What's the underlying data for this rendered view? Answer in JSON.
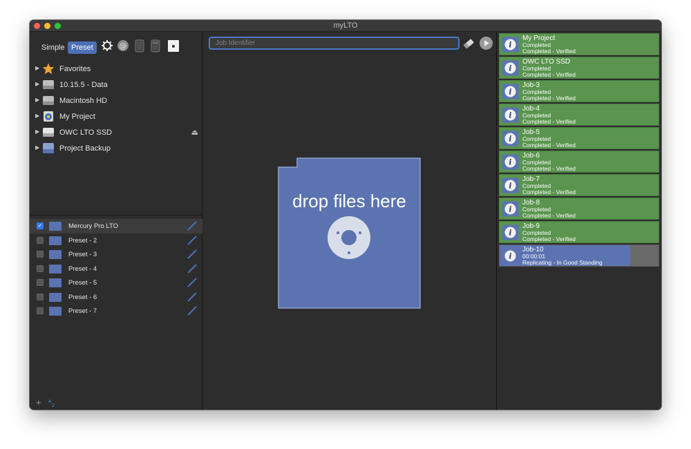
{
  "window": {
    "title": "myLTO"
  },
  "toolbar": {
    "simple_label": "Simple",
    "preset_label": "Preset"
  },
  "sources": [
    {
      "label": "Favorites",
      "icon": "star-icon"
    },
    {
      "label": "10.15.5 - Data",
      "icon": "drive-icon"
    },
    {
      "label": "Macintosh HD",
      "icon": "drive-icon"
    },
    {
      "label": "My Project",
      "icon": "project-icon"
    },
    {
      "label": "OWC LTO SSD",
      "icon": "drive-icon"
    },
    {
      "label": "Project Backup",
      "icon": "backup-drive-icon"
    }
  ],
  "presets": [
    {
      "label": "Mercury Pro LTO",
      "checked": true
    },
    {
      "label": "Preset - 2",
      "checked": false
    },
    {
      "label": "Preset - 3",
      "checked": false
    },
    {
      "label": "Preset - 4",
      "checked": false
    },
    {
      "label": "Preset - 5",
      "checked": false
    },
    {
      "label": "Preset - 6",
      "checked": false
    },
    {
      "label": "Preset - 7",
      "checked": false
    }
  ],
  "job_input": {
    "placeholder": "Job Identifier"
  },
  "drop_zone": {
    "text": "drop files here"
  },
  "jobs": [
    {
      "name": "My Project",
      "line2": "Completed",
      "line3": "Completed - Verified",
      "state": "done"
    },
    {
      "name": "OWC LTO SSD",
      "line2": "Completed",
      "line3": "Completed - Verified",
      "state": "done"
    },
    {
      "name": "Job-3",
      "line2": "Completed",
      "line3": "Completed - Verified",
      "state": "done"
    },
    {
      "name": "Job-4",
      "line2": "Completed",
      "line3": "Completed - Verified",
      "state": "done"
    },
    {
      "name": "Job-5",
      "line2": "Completed",
      "line3": "Completed - Verified",
      "state": "done"
    },
    {
      "name": "Job-6",
      "line2": "Completed",
      "line3": "Completed - Verified",
      "state": "done"
    },
    {
      "name": "Job-7",
      "line2": "Completed",
      "line3": "Completed - Verified",
      "state": "done"
    },
    {
      "name": "Job-8",
      "line2": "Completed",
      "line3": "Completed - Verified",
      "state": "done"
    },
    {
      "name": "Job-9",
      "line2": "Completed",
      "line3": "Completed - Verified",
      "state": "done"
    },
    {
      "name": "Job-10",
      "line2": "00:00:01",
      "line3": "Replicating - In Good Standing",
      "state": "active",
      "progress": 0.82
    }
  ],
  "colors": {
    "accent": "#4c6fb5",
    "done": "#5a944e",
    "tape": "#5b73b0"
  }
}
